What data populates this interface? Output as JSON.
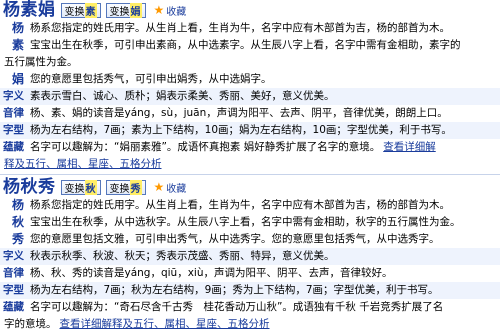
{
  "names": [
    {
      "name": "杨素娟",
      "swap1": {
        "prefix": "变换",
        "char": "素"
      },
      "swap2": {
        "prefix": "变换",
        "char": "娟"
      },
      "fav": "收藏",
      "meanings": [
        {
          "ch": "杨",
          "text": "杨系您指定的姓氏用字。从生肖上看，生肖为牛，名字中应有木部首为吉，杨的部首为木。"
        },
        {
          "ch": "素",
          "text_a": "宝宝出生在秋季，可引申出素商，从中选素字。从生辰八字上看，名字中需有金相助，素字的",
          "text_b": "五行属性为金。"
        },
        {
          "ch": "娟",
          "text": "您的意愿里包括秀气，可引申出娟秀，从中选娟字。"
        }
      ],
      "ziyi": {
        "label": "字义",
        "text": "素表示雪白、诚心、质朴；娟表示柔美、秀丽、美好，意义优美。"
      },
      "yinlv": {
        "label": "音律",
        "text": "杨、素、娟的读音是yáng，sù，juān，声调为阳平、去声、阴平，音律优美，朗朗上口。"
      },
      "zixing": {
        "label": "字型",
        "text": "杨为左右结构，7画；素为上下结构，10画；娟为左右结构，10画；字型优美，利于书写。"
      },
      "yuncang": {
        "label": "蕴藏",
        "text": "名字可以趣解为：“娟丽素雅”。成语怀真抱素 娟好静秀扩展了名字的意境。",
        "more": "查看详细解",
        "more2": "释及五行、属相、星座、五格分析"
      }
    },
    {
      "name": "杨秋秀",
      "swap1": {
        "prefix": "变换",
        "char": "秋"
      },
      "swap2": {
        "prefix": "变换",
        "char": "秀"
      },
      "fav": "收藏",
      "meanings": [
        {
          "ch": "杨",
          "text": "杨系您指定的姓氏用字。从生肖上看，生肖为牛，名字中应有木部首为吉，杨的部首为木。"
        },
        {
          "ch": "秋",
          "text": "宝宝出生在秋季，从中选秋字。从生辰八字上看，名字中需有金相助，秋字的五行属性为金。"
        },
        {
          "ch": "秀",
          "text": "您的意愿里包括文雅，可引申出秀气，从中选秀字。您的意愿里包括秀气，从中选秀字。"
        }
      ],
      "ziyi": {
        "label": "字义",
        "text": "秋表示秋季、秋波、秋天；秀表示茂盛、秀丽、特异，意义优美。"
      },
      "yinlv": {
        "label": "音律",
        "text": "杨、秋、秀的读音是yáng，qiū，xiù，声调为阳平、阴平、去声，音律较好。"
      },
      "zixing": {
        "label": "字型",
        "text": "杨为左右结构，7画；秋为左右结构，9画；秀为上下结构，7画；字型优美，利于书写。"
      },
      "yuncang": {
        "label": "蕴藏",
        "text": "名字可以趣解为：“奇石尽含千古秀　桂花香动万山秋”。成语独有千秋 千岩竞秀扩展了名",
        "text_b": "字的意境。",
        "more": "查看详细解释及五行、属相、星座、五格分析"
      }
    }
  ]
}
